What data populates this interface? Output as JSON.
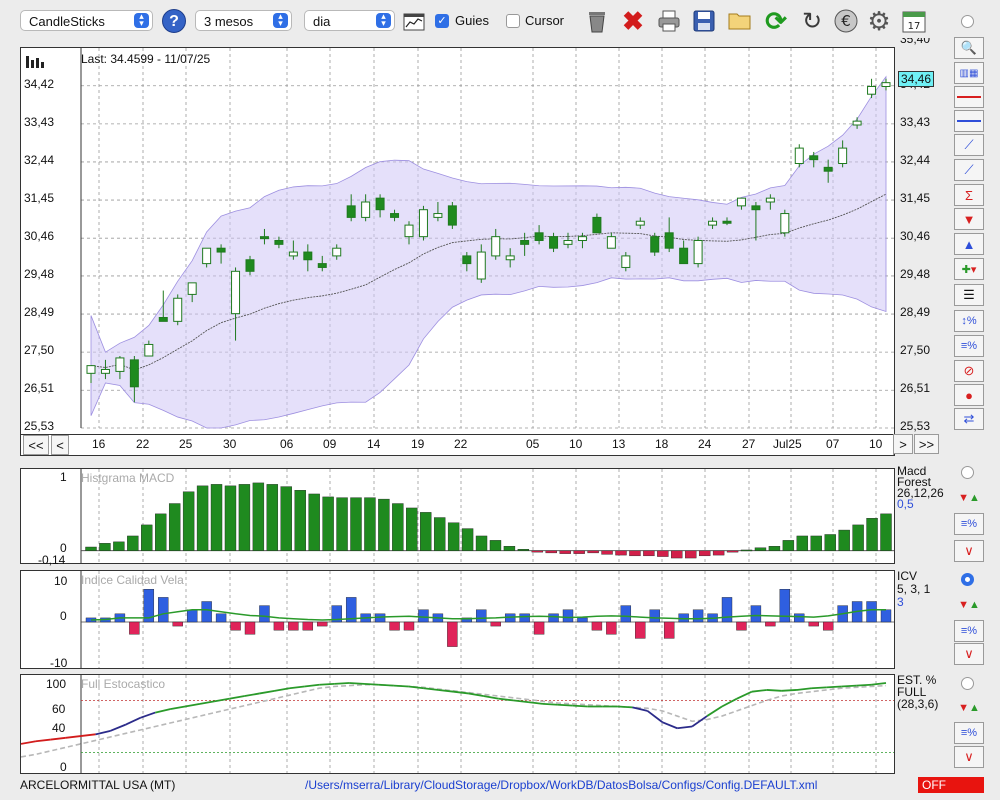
{
  "toolbar": {
    "chart_type": "CandleSticks",
    "period": "3 mesos",
    "interval": "dia",
    "guides_label": "Guies",
    "guides_checked": true,
    "cursor_label": "Cursor",
    "cursor_checked": false,
    "help_label": "?",
    "icons": [
      "chart-type-icon",
      "trash-icon",
      "delete-icon",
      "print-icon",
      "save-icon",
      "open-folder-icon",
      "refresh-icon",
      "reload-icon",
      "currency-icon",
      "settings-icon",
      "calendar-icon"
    ],
    "calendar_day": "17"
  },
  "price_panel": {
    "last_label": "Last: 34.4599 - 11/07/25",
    "current_price_tag": "34,46",
    "y_ticks": [
      "25,53",
      "26,51",
      "27,50",
      "28,49",
      "29,48",
      "30,46",
      "31,45",
      "32,44",
      "33,43",
      "34,42"
    ],
    "right_top_tick": "35,40",
    "x_ticks": [
      "16",
      "22",
      "25",
      "30",
      "06",
      "09",
      "14",
      "19",
      "22",
      "05",
      "10",
      "13",
      "18",
      "24",
      "27",
      "Jul25",
      "07",
      "10"
    ],
    "nav": {
      "first": "<<",
      "prev": "<",
      "next": ">",
      "last": ">>"
    }
  },
  "macd_panel": {
    "title": "Histgrama MACD",
    "y_ticks": [
      "1",
      "0",
      "-0,14"
    ],
    "legend": [
      "Macd",
      "Forest",
      "26,12,26",
      "0,5"
    ]
  },
  "icv_panel": {
    "title": "Indice Calidad Vela",
    "y_ticks": [
      "10",
      "0",
      "-10"
    ],
    "legend": [
      "ICV",
      "5, 3, 1",
      "3"
    ]
  },
  "stoch_panel": {
    "title": "Full Estocastico",
    "y_ticks": [
      "100",
      "60",
      "40",
      "0"
    ],
    "legend": [
      "EST. %",
      "FULL",
      "(28,3,6)"
    ]
  },
  "status": {
    "company": "ARCELORMITTAL USA (MT)",
    "path": "/Users/mserra/Library/CloudStorage/Dropbox/WorkDB/DatosBolsa/Configs/Config.DEFAULT.xml",
    "mode": "OFF"
  },
  "colors": {
    "up": "#ffffff",
    "down": "#1f8a1f",
    "band": "#cfc6f5",
    "panel_border": "#333333",
    "accent": "#2f6fe6"
  },
  "chart_data": [
    {
      "type": "candlestick",
      "ylim": [
        25.53,
        35.4
      ],
      "x": [
        "16",
        "22",
        "25",
        "30",
        "06",
        "09",
        "14",
        "19",
        "22",
        "05",
        "10",
        "13",
        "18",
        "24",
        "27",
        "Jul25",
        "07",
        "10"
      ],
      "candles": [
        {
          "o": 26.95,
          "h": 27.1,
          "l": 26.7,
          "c": 27.15,
          "up": true
        },
        {
          "o": 26.95,
          "h": 27.3,
          "l": 26.8,
          "c": 27.05,
          "up": true
        },
        {
          "o": 27.0,
          "h": 27.4,
          "l": 26.8,
          "c": 27.35,
          "up": true
        },
        {
          "o": 27.3,
          "h": 27.4,
          "l": 26.2,
          "c": 26.6,
          "up": false
        },
        {
          "o": 27.4,
          "h": 27.8,
          "l": 27.4,
          "c": 27.7,
          "up": true
        },
        {
          "o": 28.4,
          "h": 29.1,
          "l": 28.3,
          "c": 28.3,
          "up": false
        },
        {
          "o": 28.3,
          "h": 29.0,
          "l": 28.2,
          "c": 28.9,
          "up": true
        },
        {
          "o": 29.0,
          "h": 29.2,
          "l": 28.8,
          "c": 29.3,
          "up": true
        },
        {
          "o": 29.8,
          "h": 30.2,
          "l": 29.7,
          "c": 30.2,
          "up": true
        },
        {
          "o": 30.2,
          "h": 30.3,
          "l": 29.8,
          "c": 30.1,
          "up": false
        },
        {
          "o": 28.5,
          "h": 29.7,
          "l": 27.8,
          "c": 29.6,
          "up": true
        },
        {
          "o": 29.9,
          "h": 30.0,
          "l": 29.5,
          "c": 29.6,
          "up": false
        },
        {
          "o": 30.5,
          "h": 30.7,
          "l": 30.3,
          "c": 30.5,
          "up": false
        },
        {
          "o": 30.4,
          "h": 30.5,
          "l": 30.2,
          "c": 30.3,
          "up": false
        },
        {
          "o": 30.0,
          "h": 30.4,
          "l": 29.9,
          "c": 30.1,
          "up": true
        },
        {
          "o": 30.1,
          "h": 30.3,
          "l": 29.6,
          "c": 29.9,
          "up": false
        },
        {
          "o": 29.8,
          "h": 30.0,
          "l": 29.6,
          "c": 29.7,
          "up": false
        },
        {
          "o": 30.0,
          "h": 30.3,
          "l": 29.9,
          "c": 30.2,
          "up": true
        },
        {
          "o": 31.3,
          "h": 31.6,
          "l": 30.9,
          "c": 31.0,
          "up": false
        },
        {
          "o": 31.0,
          "h": 31.6,
          "l": 30.9,
          "c": 31.4,
          "up": true
        },
        {
          "o": 31.5,
          "h": 31.6,
          "l": 31.0,
          "c": 31.2,
          "up": false
        },
        {
          "o": 31.1,
          "h": 31.2,
          "l": 30.9,
          "c": 31.0,
          "up": false
        },
        {
          "o": 30.5,
          "h": 30.9,
          "l": 30.3,
          "c": 30.8,
          "up": true
        },
        {
          "o": 30.5,
          "h": 31.3,
          "l": 30.4,
          "c": 31.2,
          "up": true
        },
        {
          "o": 31.0,
          "h": 31.4,
          "l": 30.9,
          "c": 31.1,
          "up": true
        },
        {
          "o": 31.3,
          "h": 31.4,
          "l": 30.7,
          "c": 30.8,
          "up": false
        },
        {
          "o": 30.0,
          "h": 30.1,
          "l": 29.6,
          "c": 29.8,
          "up": false
        },
        {
          "o": 29.4,
          "h": 30.3,
          "l": 29.3,
          "c": 30.1,
          "up": true
        },
        {
          "o": 30.0,
          "h": 30.7,
          "l": 29.9,
          "c": 30.5,
          "up": true
        },
        {
          "o": 29.9,
          "h": 30.2,
          "l": 29.7,
          "c": 30.0,
          "up": true
        },
        {
          "o": 30.4,
          "h": 30.6,
          "l": 30.0,
          "c": 30.3,
          "up": false
        },
        {
          "o": 30.6,
          "h": 30.8,
          "l": 30.3,
          "c": 30.4,
          "up": false
        },
        {
          "o": 30.5,
          "h": 30.6,
          "l": 30.1,
          "c": 30.2,
          "up": false
        },
        {
          "o": 30.3,
          "h": 30.6,
          "l": 30.2,
          "c": 30.4,
          "up": true
        },
        {
          "o": 30.4,
          "h": 30.6,
          "l": 30.2,
          "c": 30.5,
          "up": true
        },
        {
          "o": 31.0,
          "h": 31.1,
          "l": 30.6,
          "c": 30.6,
          "up": false
        },
        {
          "o": 30.2,
          "h": 30.6,
          "l": 30.2,
          "c": 30.5,
          "up": true
        },
        {
          "o": 29.7,
          "h": 30.1,
          "l": 29.6,
          "c": 30.0,
          "up": true
        },
        {
          "o": 30.9,
          "h": 31.0,
          "l": 30.7,
          "c": 30.8,
          "up": true
        },
        {
          "o": 30.5,
          "h": 30.6,
          "l": 30.0,
          "c": 30.1,
          "up": false
        },
        {
          "o": 30.2,
          "h": 31.0,
          "l": 30.1,
          "c": 30.6,
          "up": false
        },
        {
          "o": 30.2,
          "h": 30.4,
          "l": 29.8,
          "c": 29.8,
          "up": false
        },
        {
          "o": 29.8,
          "h": 30.5,
          "l": 29.7,
          "c": 30.4,
          "up": true
        },
        {
          "o": 30.8,
          "h": 31.0,
          "l": 30.7,
          "c": 30.9,
          "up": true
        },
        {
          "o": 30.9,
          "h": 31.0,
          "l": 30.8,
          "c": 30.9,
          "up": false
        },
        {
          "o": 31.3,
          "h": 31.5,
          "l": 31.2,
          "c": 31.5,
          "up": true
        },
        {
          "o": 31.3,
          "h": 31.4,
          "l": 30.4,
          "c": 31.2,
          "up": false
        },
        {
          "o": 31.4,
          "h": 31.6,
          "l": 31.2,
          "c": 31.5,
          "up": true
        },
        {
          "o": 30.6,
          "h": 31.2,
          "l": 30.5,
          "c": 31.1,
          "up": true
        },
        {
          "o": 32.4,
          "h": 32.9,
          "l": 32.3,
          "c": 32.8,
          "up": true
        },
        {
          "o": 32.6,
          "h": 32.7,
          "l": 32.3,
          "c": 32.5,
          "up": false
        },
        {
          "o": 32.2,
          "h": 32.5,
          "l": 31.9,
          "c": 32.3,
          "up": false
        },
        {
          "o": 32.4,
          "h": 33.0,
          "l": 32.3,
          "c": 32.8,
          "up": true
        },
        {
          "o": 33.4,
          "h": 33.6,
          "l": 33.3,
          "c": 33.5,
          "up": true
        },
        {
          "o": 34.2,
          "h": 34.6,
          "l": 34.1,
          "c": 34.4,
          "up": true
        },
        {
          "o": 34.4,
          "h": 34.6,
          "l": 34.3,
          "c": 34.5,
          "up": true
        }
      ]
    },
    {
      "type": "bar",
      "title": "Histgrama MACD",
      "ylim": [
        -0.14,
        1
      ],
      "values": [
        0.05,
        0.1,
        0.12,
        0.2,
        0.35,
        0.5,
        0.64,
        0.8,
        0.88,
        0.9,
        0.88,
        0.9,
        0.92,
        0.9,
        0.87,
        0.82,
        0.77,
        0.73,
        0.72,
        0.72,
        0.72,
        0.7,
        0.64,
        0.58,
        0.52,
        0.45,
        0.38,
        0.3,
        0.2,
        0.14,
        0.06,
        0.02,
        -0.02,
        -0.03,
        -0.04,
        -0.04,
        -0.03,
        -0.05,
        -0.06,
        -0.07,
        -0.07,
        -0.08,
        -0.1,
        -0.1,
        -0.07,
        -0.06,
        -0.02,
        0.01,
        0.04,
        0.06,
        0.14,
        0.2,
        0.2,
        0.22,
        0.28,
        0.35,
        0.44,
        0.5
      ]
    },
    {
      "type": "bar",
      "title": "Indice Calidad Vela",
      "ylim": [
        -10,
        10
      ],
      "values": [
        1,
        1,
        2,
        -3,
        8,
        6,
        -1,
        3,
        5,
        2,
        -2,
        -3,
        4,
        -2,
        -2,
        -2,
        -1,
        4,
        6,
        2,
        2,
        -2,
        -2,
        3,
        2,
        -6,
        1,
        3,
        -1,
        2,
        2,
        -3,
        2,
        3,
        1,
        -2,
        -3,
        4,
        -4,
        3,
        -4,
        2,
        3,
        2,
        6,
        -2,
        4,
        -1,
        8,
        2,
        -1,
        -2,
        4,
        5,
        5,
        3
      ],
      "line": [
        0.5,
        0.6,
        1,
        1,
        1,
        2,
        2.5,
        3,
        3,
        2.5,
        2,
        1.6,
        1.4,
        1,
        0.8,
        0.6,
        0.5,
        0.6,
        0.8,
        1,
        1.2,
        1.3,
        1.4,
        1.2,
        1,
        0.8,
        0.8,
        0.9,
        1,
        1.2,
        1.3,
        1.4,
        1.3,
        1.1,
        1.2,
        1.4,
        1.5,
        1.4,
        1.2,
        1,
        0.9,
        0.8,
        0.8,
        0.9,
        1.2,
        1.4,
        1.6,
        1.5,
        1.4,
        1.3,
        1.2,
        1.5,
        2,
        2.6,
        3,
        3
      ]
    },
    {
      "type": "line",
      "title": "Full Estocastico",
      "ylim": [
        0,
        100
      ],
      "series": [
        {
          "color": "#2a9a2a",
          "values": [
            30,
            33,
            35,
            37,
            39,
            41,
            45,
            52,
            60,
            66,
            70,
            73,
            76,
            79,
            82,
            85,
            88,
            91,
            94,
            96,
            98,
            99,
            100,
            99,
            98,
            97,
            96,
            94,
            92,
            90,
            88,
            85,
            82,
            80,
            78,
            76,
            75,
            74,
            73,
            73,
            73,
            72,
            68,
            55,
            48,
            50,
            62,
            73,
            82,
            90,
            92,
            91,
            92,
            94,
            95,
            96,
            97,
            98,
            100
          ]
        },
        {
          "color": "#b8b8b8",
          "values": [
            15,
            18,
            22,
            26,
            30,
            34,
            38,
            42,
            46,
            50,
            54,
            58,
            62,
            66,
            70,
            74,
            78,
            82,
            86,
            90,
            94,
            96,
            97,
            98,
            98,
            97,
            96,
            95,
            93,
            91,
            89,
            87,
            85,
            83,
            81,
            79,
            77,
            76,
            75,
            74,
            73,
            72,
            71,
            68,
            62,
            56,
            58,
            62,
            68,
            74,
            80,
            85,
            88,
            90,
            92,
            94,
            95,
            96,
            97
          ]
        }
      ]
    }
  ]
}
